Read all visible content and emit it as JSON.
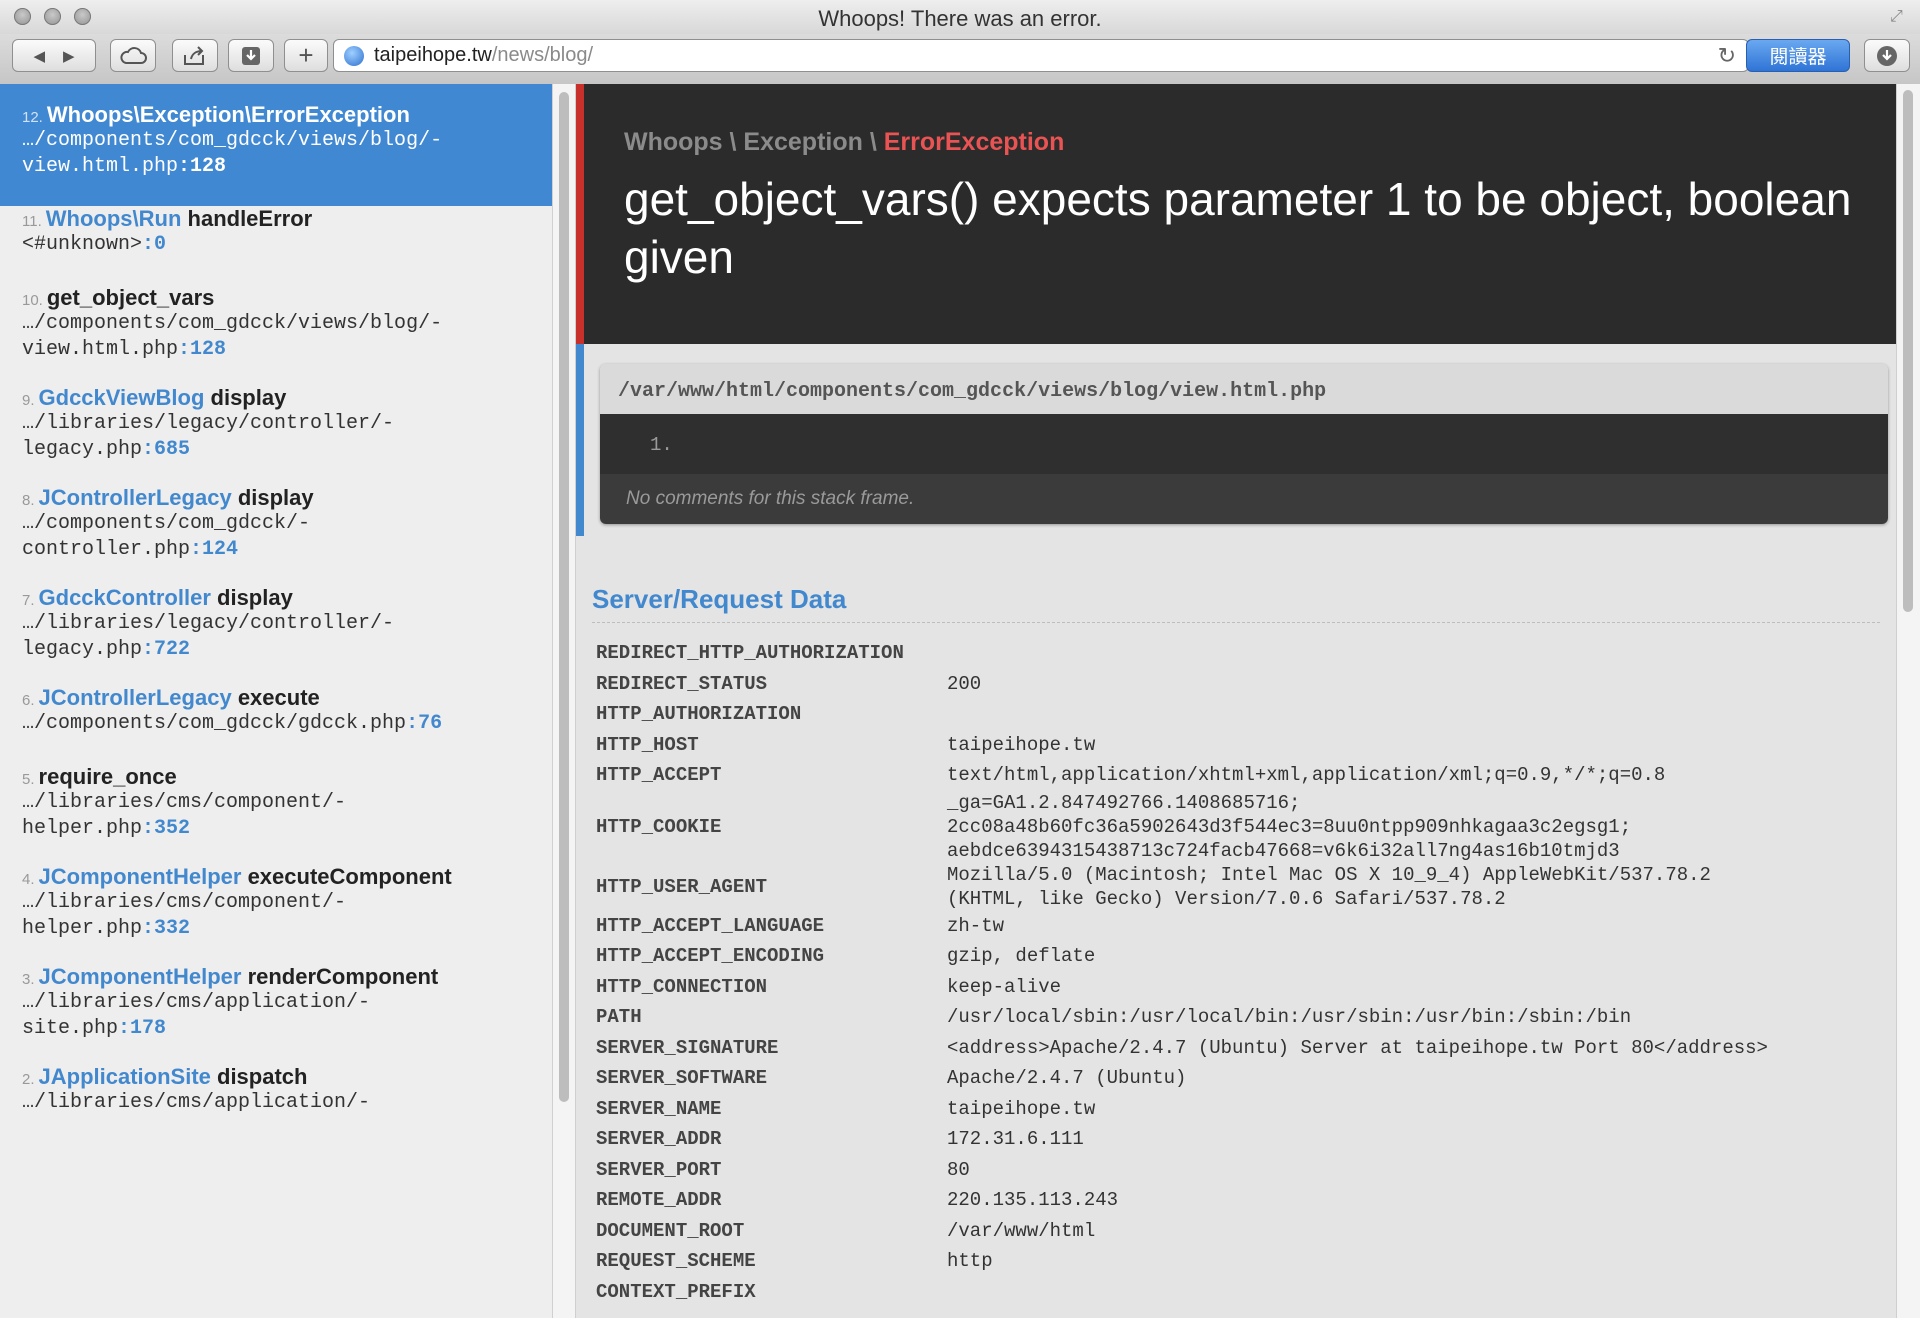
{
  "window": {
    "title": "Whoops! There was an error."
  },
  "toolbar": {
    "url_host": "taipeihope.tw",
    "url_path": "/news/blog/",
    "reader_label": "閱讀器"
  },
  "frames": [
    {
      "index": "12.",
      "class": "Whoops\\Exception\\ErrorException",
      "function": "",
      "file": "…/components/com_gdcck/views/blog/-\nview.html.php",
      "line": "128",
      "active": true
    },
    {
      "index": "11.",
      "class": "Whoops\\Run",
      "function": "handleError",
      "file": "<#unknown>",
      "line": "0"
    },
    {
      "index": "10.",
      "class": "",
      "function": "get_object_vars",
      "file": "…/components/com_gdcck/views/blog/-\nview.html.php",
      "line": "128"
    },
    {
      "index": "9.",
      "class": "GdcckViewBlog",
      "function": "display",
      "file": "…/libraries/legacy/controller/-\nlegacy.php",
      "line": "685"
    },
    {
      "index": "8.",
      "class": "JControllerLegacy",
      "function": "display",
      "file": "…/components/com_gdcck/-\ncontroller.php",
      "line": "124"
    },
    {
      "index": "7.",
      "class": "GdcckController",
      "function": "display",
      "file": "…/libraries/legacy/controller/-\nlegacy.php",
      "line": "722"
    },
    {
      "index": "6.",
      "class": "JControllerLegacy",
      "function": "execute",
      "file": "…/components/com_gdcck/gdcck.php",
      "line": "76"
    },
    {
      "index": "5.",
      "class": "",
      "function": "require_once",
      "file": "…/libraries/cms/component/-\nhelper.php",
      "line": "352"
    },
    {
      "index": "4.",
      "class": "JComponentHelper",
      "function": "executeComponent",
      "file": "…/libraries/cms/component/-\nhelper.php",
      "line": "332"
    },
    {
      "index": "3.",
      "class": "JComponentHelper",
      "function": "renderComponent",
      "file": "…/libraries/cms/application/-\nsite.php",
      "line": "178"
    },
    {
      "index": "2.",
      "class": "JApplicationSite",
      "function": "dispatch",
      "file": "…/libraries/cms/application/-",
      "line": ""
    }
  ],
  "exception": {
    "namespace": "Whoops \\ Exception \\ ",
    "name": "ErrorException",
    "message": "get_object_vars() expects parameter 1 to be object, boolean given"
  },
  "code": {
    "file_path": "/var/www/html/components/com_gdcck/views/blog/view.html.php",
    "line_no": "1.",
    "comment": "No comments for this stack frame."
  },
  "server": {
    "title": "Server/Request Data",
    "rows": [
      {
        "key": "REDIRECT_HTTP_AUTHORIZATION",
        "value": ""
      },
      {
        "key": "REDIRECT_STATUS",
        "value": "200"
      },
      {
        "key": "HTTP_AUTHORIZATION",
        "value": ""
      },
      {
        "key": "HTTP_HOST",
        "value": "taipeihope.tw"
      },
      {
        "key": "HTTP_ACCEPT",
        "value": "text/html,application/xhtml+xml,application/xml;q=0.9,*/*;q=0.8"
      },
      {
        "key": "HTTP_COOKIE",
        "value": "_ga=GA1.2.847492766.1408685716;\n2cc08a48b60fc36a5902643d3f544ec3=8uu0ntpp909nhkagaa3c2egsg1;\naebdce6394315438713c724facb47668=v6k6i32all7ng4as16b10tmjd3"
      },
      {
        "key": "HTTP_USER_AGENT",
        "value": "Mozilla/5.0 (Macintosh; Intel Mac OS X 10_9_4) AppleWebKit/537.78.2\n(KHTML, like Gecko) Version/7.0.6 Safari/537.78.2"
      },
      {
        "key": "HTTP_ACCEPT_LANGUAGE",
        "value": "zh-tw"
      },
      {
        "key": "HTTP_ACCEPT_ENCODING",
        "value": "gzip, deflate"
      },
      {
        "key": "HTTP_CONNECTION",
        "value": "keep-alive"
      },
      {
        "key": "PATH",
        "value": "/usr/local/sbin:/usr/local/bin:/usr/sbin:/usr/bin:/sbin:/bin"
      },
      {
        "key": "SERVER_SIGNATURE",
        "value": "<address>Apache/2.4.7 (Ubuntu) Server at taipeihope.tw Port 80</address>"
      },
      {
        "key": "SERVER_SOFTWARE",
        "value": "Apache/2.4.7 (Ubuntu)"
      },
      {
        "key": "SERVER_NAME",
        "value": "taipeihope.tw"
      },
      {
        "key": "SERVER_ADDR",
        "value": "172.31.6.111"
      },
      {
        "key": "SERVER_PORT",
        "value": "80"
      },
      {
        "key": "REMOTE_ADDR",
        "value": "220.135.113.243"
      },
      {
        "key": "DOCUMENT_ROOT",
        "value": "/var/www/html"
      },
      {
        "key": "REQUEST_SCHEME",
        "value": "http"
      },
      {
        "key": "CONTEXT_PREFIX",
        "value": ""
      }
    ]
  },
  "colors": {
    "accent_blue": "#4288ce",
    "active_frame_bg": "#4188d2",
    "error_red": "#e95353",
    "header_bg": "#2b2b2b"
  }
}
